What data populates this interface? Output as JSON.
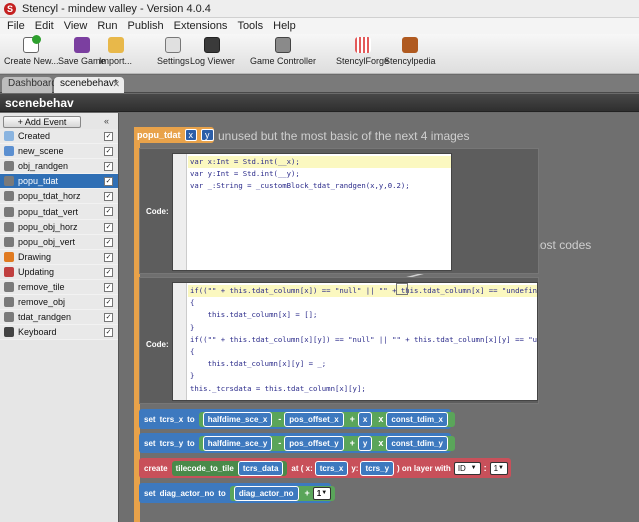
{
  "window": {
    "title": "Stencyl - mindew valley - Version 4.0.4",
    "logo": "S"
  },
  "menu": [
    "File",
    "Edit",
    "View",
    "Run",
    "Publish",
    "Extensions",
    "Tools",
    "Help"
  ],
  "toolbar": {
    "create_new": "Create New...",
    "save_game": "Save Game",
    "import": "Import...",
    "settings": "Settings",
    "log_viewer": "Log Viewer",
    "game_controller": "Game Controller",
    "stencylforge": "StencylForge",
    "stencylpedia": "Stencylpedia"
  },
  "tabs": [
    {
      "label": "Dashboard"
    },
    {
      "label": "scenebehav*"
    }
  ],
  "header": {
    "title": "scenebehav"
  },
  "sidebar": {
    "add_event": "+ Add Event",
    "items": [
      {
        "label": "Created",
        "icon": "created-icon",
        "color": "#8ab4e0",
        "selected": false
      },
      {
        "label": "new_scene",
        "icon": "scene-icon",
        "color": "#5b8fd0",
        "selected": false
      },
      {
        "label": "obj_randgen",
        "icon": "code-icon",
        "color": "#7a7a7a",
        "selected": false
      },
      {
        "label": "popu_tdat",
        "icon": "code-icon",
        "color": "#7a7a7a",
        "selected": true
      },
      {
        "label": "popu_tdat_horz",
        "icon": "code-icon",
        "color": "#7a7a7a",
        "selected": false
      },
      {
        "label": "popu_tdat_vert",
        "icon": "code-icon",
        "color": "#7a7a7a",
        "selected": false
      },
      {
        "label": "popu_obj_horz",
        "icon": "code-icon",
        "color": "#7a7a7a",
        "selected": false
      },
      {
        "label": "popu_obj_vert",
        "icon": "code-icon",
        "color": "#7a7a7a",
        "selected": false
      },
      {
        "label": "Drawing",
        "icon": "drawing-icon",
        "color": "#e07a20",
        "selected": false
      },
      {
        "label": "Updating",
        "icon": "updating-icon",
        "color": "#c04040",
        "selected": false
      },
      {
        "label": "remove_tile",
        "icon": "code-icon",
        "color": "#7a7a7a",
        "selected": false
      },
      {
        "label": "remove_obj",
        "icon": "code-icon",
        "color": "#7a7a7a",
        "selected": false
      },
      {
        "label": "tdat_randgen",
        "icon": "code-icon",
        "color": "#7a7a7a",
        "selected": false
      },
      {
        "label": "Keyboard",
        "icon": "keyboard-icon",
        "color": "#444444",
        "selected": false
      }
    ]
  },
  "canvas": {
    "event_title": "popu_tdat",
    "param_x": "x",
    "param_y": "y",
    "note_top": "unused but the most basic of the next 4 images",
    "note_or": "the \"or\" for most codes",
    "code_label": "Code:",
    "code1": [
      "var x:Int = Std.int(__x);",
      "var y:Int = Std.int(__y);",
      "var _:String = _customBlock_tdat_randgen(x,y,0.2);"
    ],
    "code2": [
      "if((\"\" + this.tdat_column[x]) == \"null\" || \"\" + this.tdat_column[x] == \"undefined\")",
      "{",
      "    this.tdat_column[x] = [];",
      "}",
      "if((\"\" + this.tdat_column[x][y]) == \"null\" || \"\" + this.tdat_column[x][y] == \"undefined\")",
      "{",
      "    this.tdat_column[x][y] = _;",
      "}",
      "this._tcrsdata = this.tdat_column[x][y];"
    ],
    "set_x": {
      "set": "set",
      "var": "tcrs_x",
      "to": "to",
      "a": "halfdime_sce_x",
      "minus": "-",
      "b": "pos_offset_x",
      "plus": "+",
      "c": "x",
      "times": "x",
      "d": "const_tdim_x"
    },
    "set_y": {
      "set": "set",
      "var": "tcrs_y",
      "to": "to",
      "a": "halfdime_sce_y",
      "minus": "-",
      "b": "pos_offset_y",
      "plus": "+",
      "c": "y",
      "times": "x",
      "d": "const_tdim_y"
    },
    "create": {
      "create": "create",
      "kind": "tilecode_to_tile",
      "data": "tcrs_data",
      "at": "at ( x:",
      "x": "tcrs_x",
      "ylab": "y:",
      "y": "tcrs_y",
      "onlayer": ") on layer with",
      "id": "ID",
      "layer": "1"
    },
    "set_diag": {
      "set": "set",
      "var": "diag_actor_no",
      "to": "to",
      "a": "diag_actor_no",
      "plus": "+",
      "b": "1"
    }
  }
}
